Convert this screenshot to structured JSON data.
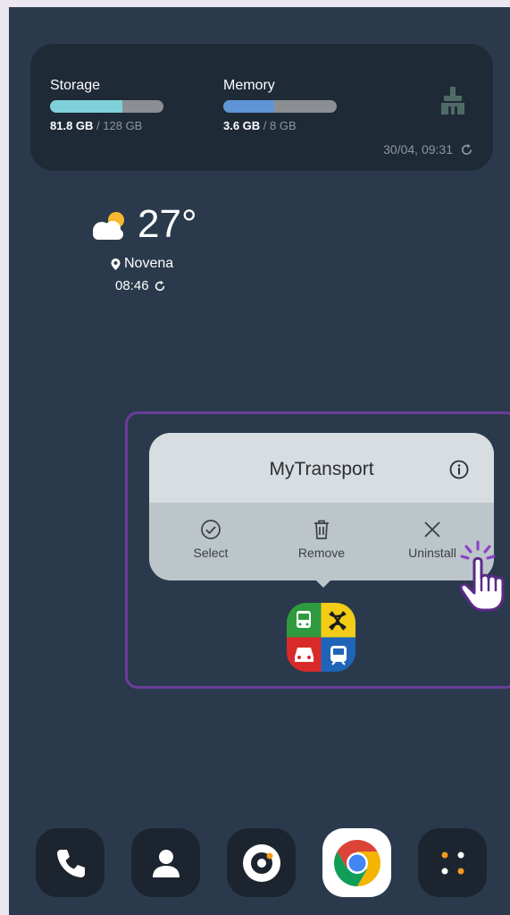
{
  "storage_widget": {
    "storage": {
      "label": "Storage",
      "used": "81.8 GB",
      "separator": " / ",
      "total": "128 GB",
      "fraction": 0.639
    },
    "memory": {
      "label": "Memory",
      "used": "3.6 GB",
      "separator": " / ",
      "total": "8 GB",
      "fraction": 0.45
    },
    "updated": "30/04, 09:31",
    "icon": "clean-brush-icon"
  },
  "weather": {
    "temperature": "27°",
    "location": "Novena",
    "time": "08:46",
    "icon": "partly-cloudy-icon"
  },
  "context_menu": {
    "title": "MyTransport",
    "actions": [
      {
        "label": "Select",
        "icon": "check-circle-icon"
      },
      {
        "label": "Remove",
        "icon": "trash-icon"
      },
      {
        "label": "Uninstall",
        "icon": "close-icon"
      }
    ]
  },
  "app": {
    "name": "MyTransport",
    "icon": "mytransport-app-icon"
  },
  "dock": [
    {
      "app": "phone",
      "icon": "phone-icon"
    },
    {
      "app": "contacts",
      "icon": "contacts-icon"
    },
    {
      "app": "camera",
      "icon": "camera-icon"
    },
    {
      "app": "chrome",
      "icon": "chrome-icon"
    },
    {
      "app": "app-drawer",
      "icon": "apps-dots-icon"
    }
  ],
  "colors": {
    "background": "#2a3a4c",
    "storage_fill": "#7fd0d8",
    "memory_fill": "#5f95d6",
    "highlight": "#6a3d9a",
    "popup": "#bcc5ca"
  }
}
